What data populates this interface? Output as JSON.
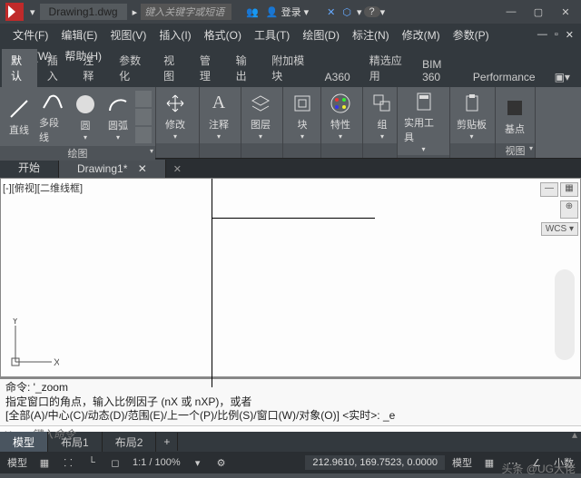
{
  "titlebar": {
    "doc_tab": "Drawing1.dwg",
    "search_placeholder": "键入关键字或短语",
    "login": "登录"
  },
  "menus": {
    "row1": [
      "文件(F)",
      "编辑(E)",
      "视图(V)",
      "插入(I)",
      "格式(O)",
      "工具(T)",
      "绘图(D)",
      "标注(N)",
      "修改(M)",
      "参数(P)"
    ],
    "row2": [
      "窗口(W)",
      "帮助(H)"
    ]
  },
  "ribbon_tabs": [
    "默认",
    "插入",
    "注释",
    "参数化",
    "视图",
    "管理",
    "输出",
    "附加模块",
    "A360",
    "精选应用",
    "BIM 360",
    "Performance"
  ],
  "ribbon": {
    "draw": {
      "title": "绘图",
      "line": "直线",
      "pline": "多段线",
      "circle": "圆",
      "arc": "圆弧"
    },
    "modify": {
      "title": "修改"
    },
    "annot": {
      "title": "注释"
    },
    "layer": {
      "title": "图层"
    },
    "block": {
      "title": "块"
    },
    "prop": {
      "title": "特性"
    },
    "group": {
      "title": "组"
    },
    "util": {
      "title": "实用工具"
    },
    "clip": {
      "title": "剪贴板"
    },
    "base": {
      "title": "基点"
    },
    "view_lbl": "视图"
  },
  "doc_tabs": {
    "start": "开始",
    "d1": "Drawing1*"
  },
  "viewport": {
    "label": "[-][俯视][二维线框]",
    "wcs": "WCS",
    "y": "Y",
    "x": "X"
  },
  "cmd": {
    "line1": "命令: '_zoom",
    "line2": "指定窗口的角点，输入比例因子 (nX 或 nXP)，或者",
    "line3": "[全部(A)/中心(C)/动态(D)/范围(E)/上一个(P)/比例(S)/窗口(W)/对象(O)] <实时>: _e",
    "placeholder": "键入命令"
  },
  "layout_tabs": [
    "模型",
    "布局1",
    "布局2"
  ],
  "status": {
    "model": "模型",
    "zoom": "1:1 / 100%",
    "coord": "212.9610, 169.7523, 0.0000",
    "space": "模型",
    "dec": "小数"
  },
  "watermark": "头条 @UG大佬"
}
